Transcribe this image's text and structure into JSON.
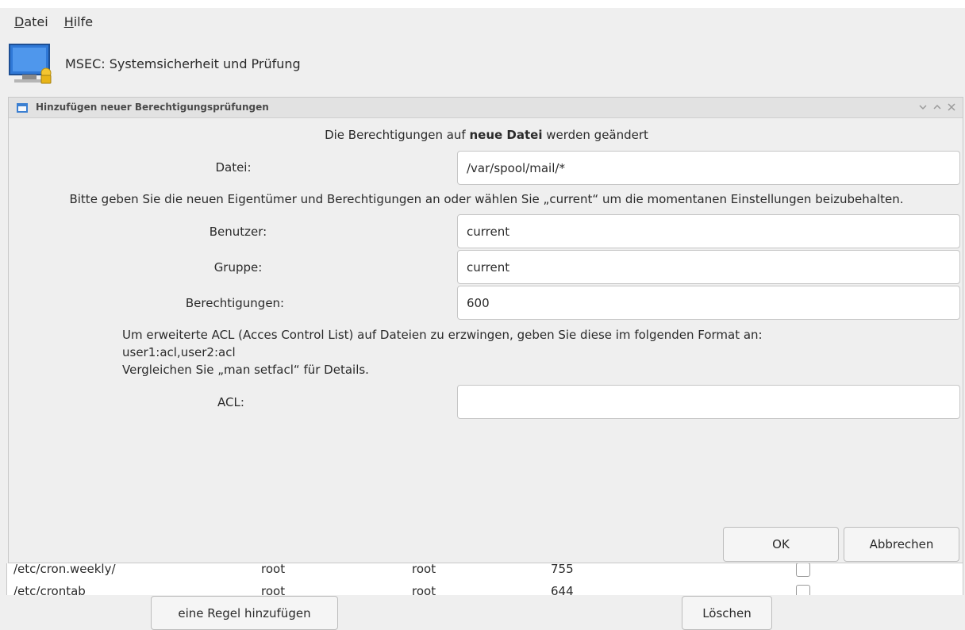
{
  "menubar": {
    "file_mnemonic": "D",
    "file_rest": "atei",
    "help_mnemonic": "H",
    "help_rest": "ilfe"
  },
  "app": {
    "title": "MSEC: Systemsicherheit und Prüfung",
    "icon": "monitor-shield-icon"
  },
  "dialog": {
    "title": "Hinzufügen neuer Berechtigungsprüfungen",
    "heading_prefix": "Die Berechtigungen auf ",
    "heading_bold": "neue Datei",
    "heading_suffix": " werden geändert",
    "file_label": "Datei:",
    "file_value": "/var/spool/mail/*",
    "hint": "Bitte geben Sie die neuen Eigentümer und Berechtigungen an oder wählen Sie „current“ um die momentanen Einstellungen beizubehalten.",
    "user_label": "Benutzer:",
    "user_value": "current",
    "group_label": "Gruppe:",
    "group_value": "current",
    "perm_label": "Berechtigungen:",
    "perm_value": "600",
    "acl_note_line1": "Um erweiterte ACL (Acces Control List) auf Dateien zu erzwingen, geben Sie diese im folgenden Format an:",
    "acl_note_line2": "user1:acl,user2:acl",
    "acl_note_line3": "Vergleichen Sie „man setfacl“ für Details.",
    "acl_label": "ACL:",
    "acl_value": "",
    "ok_label": "OK",
    "cancel_label": "Abbrechen",
    "window_controls": [
      "minimize-icon",
      "maximize-icon",
      "close-icon"
    ]
  },
  "table": {
    "rows": [
      {
        "path": "/etc/cron.weekly/",
        "user": "root",
        "group": "root",
        "perm": "755"
      },
      {
        "path": "/etc/crontab",
        "user": "root",
        "group": "root",
        "perm": "644"
      }
    ]
  },
  "bottom": {
    "add_rule_label": "eine Regel hinzufügen",
    "delete_label": "Löschen"
  },
  "colors": {
    "accent": "#3b7fd1",
    "background": "#efefef"
  }
}
